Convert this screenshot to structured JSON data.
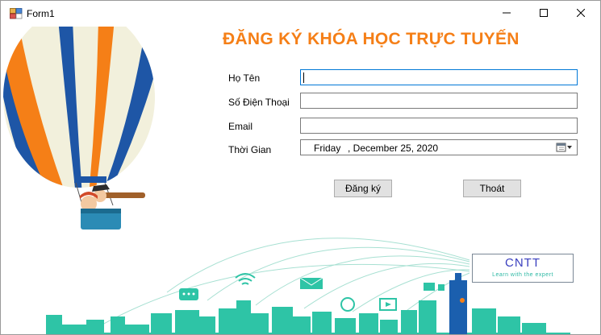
{
  "window": {
    "title": "Form1"
  },
  "form": {
    "heading": "ĐĂNG KÝ KHÓA HỌC TRỰC TUYẾN",
    "fields": {
      "name_label": "Họ Tên",
      "name_value": "",
      "phone_label": "Số Điện Thoại",
      "phone_value": "",
      "email_label": "Email",
      "email_value": "",
      "time_label": "Thời Gian",
      "date_day": "Friday",
      "date_rest": ", December 25, 2020"
    },
    "buttons": {
      "register": "Đăng ký",
      "exit": "Thoát"
    }
  },
  "branding": {
    "logo_title": "CNTT",
    "logo_subtitle": "Learn with the expert"
  },
  "colors": {
    "heading": "#f57f17",
    "city": "#2ec4a6",
    "focus_border": "#0078d7"
  },
  "icons": [
    "app-form-icon",
    "minimize-icon",
    "maximize-icon",
    "close-icon",
    "calendar-icon",
    "dropdown-arrow-icon"
  ]
}
